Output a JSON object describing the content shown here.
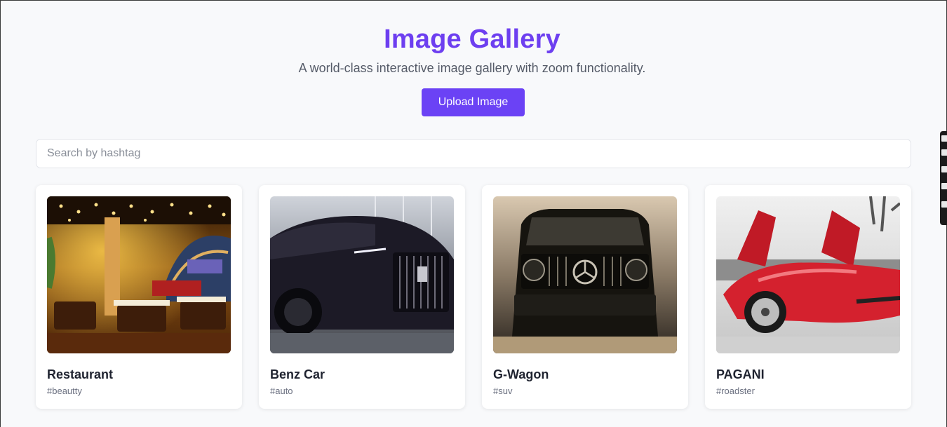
{
  "header": {
    "title": "Image Gallery",
    "subtitle": "A world-class interactive image gallery with zoom functionality.",
    "upload_label": "Upload Image"
  },
  "search": {
    "placeholder": "Search by hashtag",
    "value": ""
  },
  "cards": [
    {
      "title": "Restaurant",
      "tag": "#beautty",
      "image": "restaurant-interior"
    },
    {
      "title": "Benz Car",
      "tag": "#auto",
      "image": "black-luxury-car"
    },
    {
      "title": "G-Wagon",
      "tag": "#suv",
      "image": "black-suv-front"
    },
    {
      "title": "PAGANI",
      "tag": "#roadster",
      "image": "red-supercar"
    }
  ],
  "colors": {
    "accent": "#6b42f5",
    "title": "#6d3ff0",
    "background": "#f8f9fb"
  }
}
